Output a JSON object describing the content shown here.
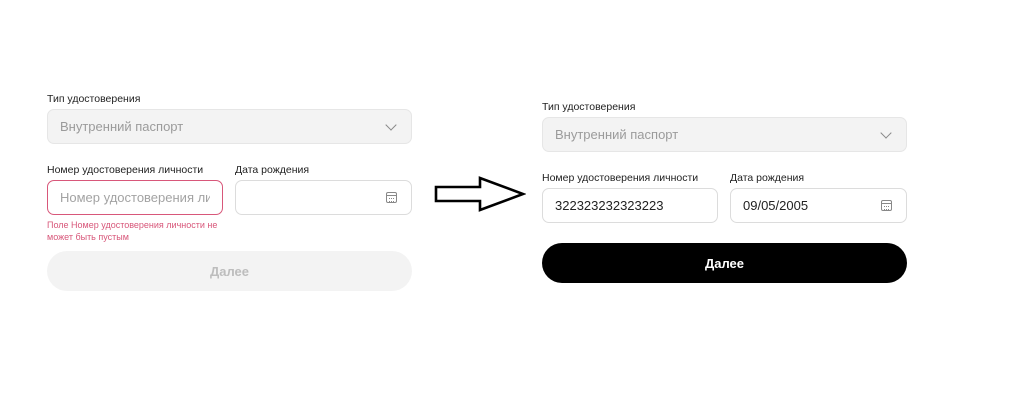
{
  "left_form": {
    "doc_type_label": "Тип удостоверения",
    "doc_type_value": "Внутренний паспорт",
    "id_label": "Номер удостоверения личности",
    "id_placeholder": "Номер удостоверения личности",
    "id_value": "",
    "birth_label": "Дата рождения",
    "birth_value": "",
    "error_text": "Поле Номер удостоверения личности не может быть пустым",
    "next_label": "Далее",
    "state": "disabled"
  },
  "right_form": {
    "doc_type_label": "Тип удостоверения",
    "doc_type_value": "Внутренний паспорт",
    "id_label": "Номер удостоверения личности",
    "id_value": "322323232323223",
    "birth_label": "Дата рождения",
    "birth_value": "09/05/2005",
    "next_label": "Далее",
    "state": "enabled"
  },
  "icons": {
    "dropdown": "chevron-down-icon",
    "calendar": "calendar-icon",
    "transition": "arrow-right-icon"
  },
  "colors": {
    "error": "#d8577a",
    "primary_button": "#000000",
    "disabled_button": "#f3f3f3"
  }
}
